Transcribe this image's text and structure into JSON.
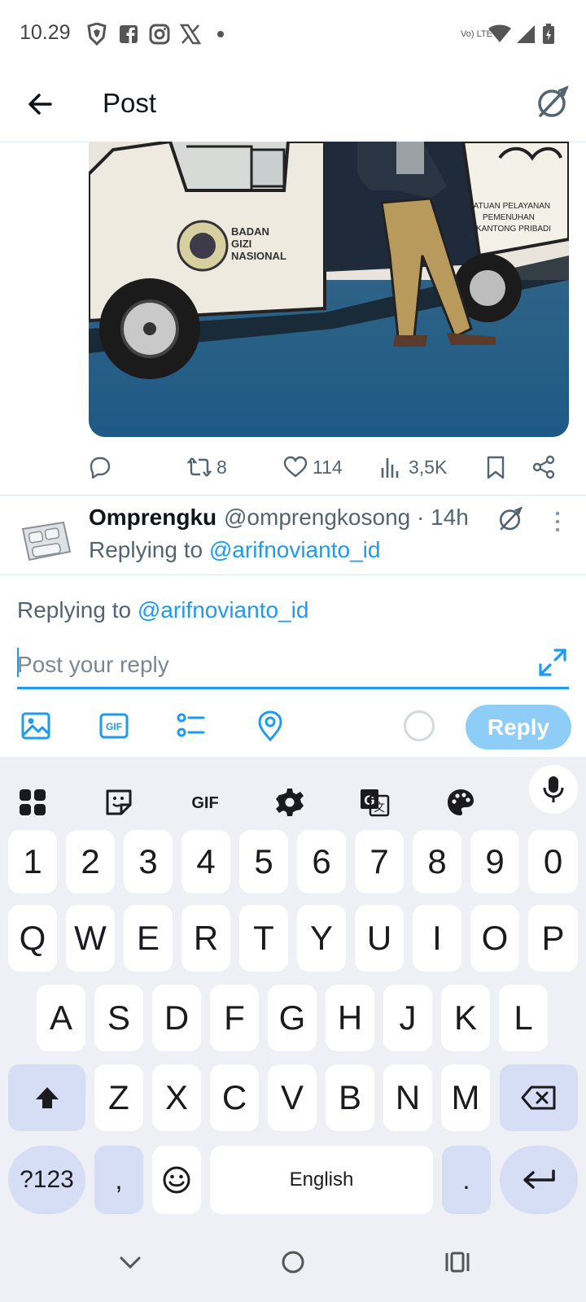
{
  "status_bar": {
    "time": "10.29",
    "network": "Vo) LTE"
  },
  "app_bar": {
    "title": "Post"
  },
  "tweet_actions": {
    "retweets": "8",
    "likes": "114",
    "views": "3,5K"
  },
  "media": {
    "van_text_1": "BADAN",
    "van_text_2": "GIZI",
    "van_text_3": "NASIONAL",
    "sign_1": "SATUAN PELAYANAN",
    "sign_2": "PEMENUHAN",
    "sign_3": "KANTONG PRIBADI"
  },
  "reply_tweet": {
    "name": "Omprengku",
    "handle": "@omprengkosong · 14h",
    "replying_prefix": "Replying to ",
    "replying_handle": "@arifnovianto_id"
  },
  "composer": {
    "replying_prefix": "Replying to ",
    "replying_handle": "@arifnovianto_id",
    "placeholder": "Post your reply",
    "reply_label": "Reply"
  },
  "keyboard": {
    "numbers": [
      "1",
      "2",
      "3",
      "4",
      "5",
      "6",
      "7",
      "8",
      "9",
      "0"
    ],
    "row1": [
      "Q",
      "W",
      "E",
      "R",
      "T",
      "Y",
      "U",
      "I",
      "O",
      "P"
    ],
    "row2": [
      "A",
      "S",
      "D",
      "F",
      "G",
      "H",
      "J",
      "K",
      "L"
    ],
    "row3": [
      "Z",
      "X",
      "C",
      "V",
      "B",
      "N",
      "M"
    ],
    "symbols_label": "?123",
    "comma": ",",
    "space_label": "English",
    "period": "."
  },
  "colors": {
    "accent": "#1d9bf0",
    "reply_button": "#8ecdf8",
    "keyboard_bg": "#eef0f6",
    "key_dark": "#d5def4"
  }
}
